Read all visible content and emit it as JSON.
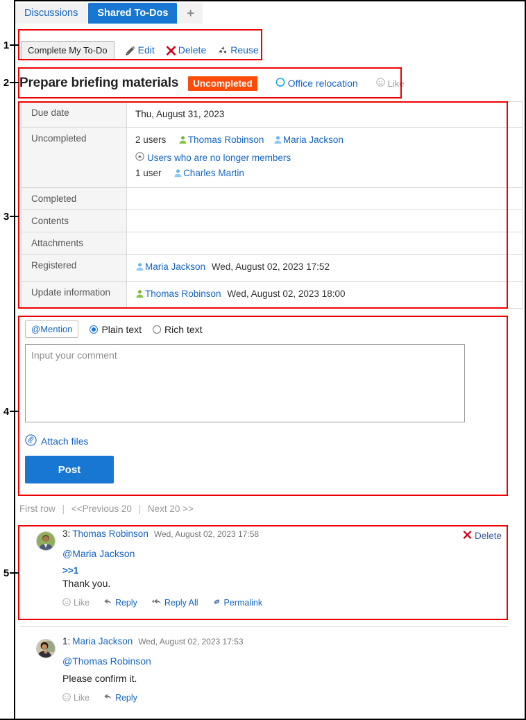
{
  "tabs": [
    {
      "label": "Discussions",
      "active": false,
      "name": "tab-discussions"
    },
    {
      "label": "Shared To-Dos",
      "active": true,
      "name": "tab-shared-todos"
    },
    {
      "label": "+",
      "active": false,
      "name": "tab-add"
    }
  ],
  "toolbar": {
    "complete_label": "Complete My To-Do",
    "edit_label": "Edit",
    "delete_label": "Delete",
    "reuse_label": "Reuse"
  },
  "title_row": {
    "title": "Prepare briefing materials",
    "status_badge": "Uncompleted",
    "category": "Office relocation",
    "like_label": "Like"
  },
  "detail": {
    "rows": [
      {
        "key": "Due date",
        "value": "Thu, August 31, 2023"
      },
      {
        "key": "Uncompleted",
        "value": ""
      },
      {
        "key": "Completed",
        "value": ""
      },
      {
        "key": "Contents",
        "value": ""
      },
      {
        "key": "Attachments",
        "value": ""
      },
      {
        "key": "Registered",
        "value": ""
      },
      {
        "key": "Update information",
        "value": ""
      }
    ],
    "uncompleted": {
      "count_label": "2 users",
      "users": [
        {
          "name": "Thomas Robinson",
          "color": "green"
        },
        {
          "name": "Maria Jackson",
          "color": "blue"
        }
      ],
      "former_members_label": "Users who are no longer members",
      "former_count_label": "1 user",
      "former_users": [
        {
          "name": "Charles Martin",
          "color": "blue"
        }
      ]
    },
    "registered": {
      "user": "Maria Jackson",
      "timestamp": "Wed, August 02, 2023 17:52"
    },
    "updated": {
      "user": "Thomas Robinson",
      "timestamp": "Wed, August 02, 2023 18:00"
    }
  },
  "form": {
    "mention_label": "@Mention",
    "plain_text_label": "Plain text",
    "rich_text_label": "Rich text",
    "selected_format": "Plain text",
    "comment_value": "",
    "comment_placeholder": "Input your comment",
    "attach_label": "Attach files",
    "post_label": "Post"
  },
  "pager": {
    "first": "First row",
    "previous": "<<Previous 20",
    "next": "Next 20 >>"
  },
  "comments": [
    {
      "number": "3:",
      "author": "Thomas Robinson",
      "timestamp": "Wed, August 02, 2023 17:58",
      "delete_label": "Delete",
      "mention": "@Maria Jackson",
      "quote": ">>1",
      "body": "Thank you.",
      "actions": [
        "Like",
        "Reply",
        "Reply All",
        "Permalink"
      ]
    },
    {
      "number": "1:",
      "author": "Maria Jackson",
      "timestamp": "Wed, August 02, 2023 17:53",
      "delete_label": "",
      "mention": "@Thomas Robinson",
      "quote": "",
      "body": "Please confirm it.",
      "actions": [
        "Like",
        "Reply"
      ]
    }
  ],
  "annotations": [
    {
      "num": "1"
    },
    {
      "num": "2"
    },
    {
      "num": "3"
    },
    {
      "num": "4"
    },
    {
      "num": "5"
    }
  ],
  "colors": {
    "accent_blue": "#1877d2",
    "link_blue": "#1565c0",
    "status_orange": "#fb4b0a",
    "annotation_red": "#ee0000",
    "delete_red": "#d0021b"
  }
}
